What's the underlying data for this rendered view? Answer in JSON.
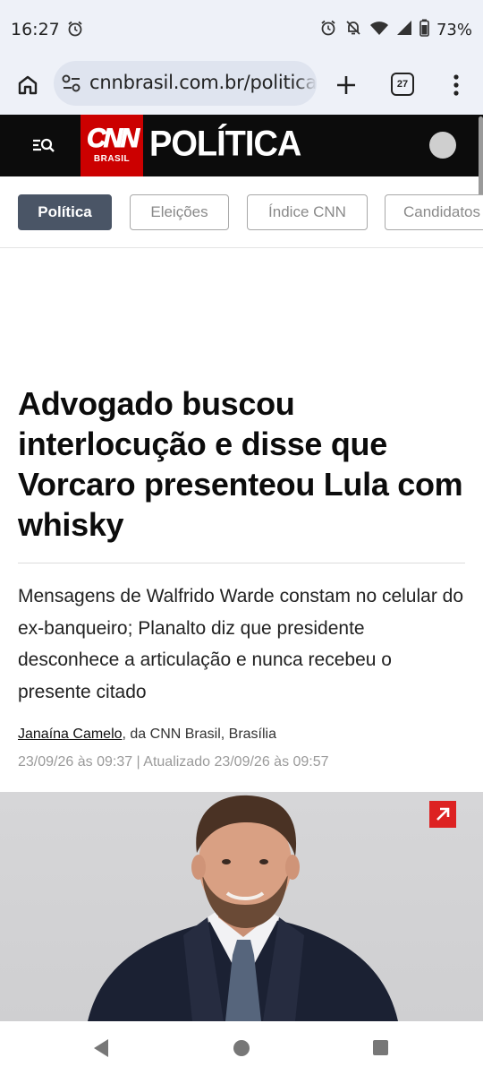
{
  "status_bar": {
    "time": "16:27",
    "battery": "73%",
    "icons": [
      "alarm-icon",
      "alarm-icon",
      "bell-off-icon",
      "wifi-icon",
      "signal-icon",
      "battery-icon"
    ]
  },
  "browser": {
    "url": "cnnbrasil.com.br/politica",
    "tab_count": "27",
    "icons": [
      "home-icon",
      "tune-icon",
      "plus-icon",
      "more-vert-icon"
    ]
  },
  "site_header": {
    "logo_text": "CNN",
    "logo_subtext": "BRASIL",
    "section_title": "POLÍTICA",
    "icons": [
      "menu-search-icon",
      "user-avatar"
    ]
  },
  "categories": [
    {
      "label": "Política",
      "active": true
    },
    {
      "label": "Eleições",
      "active": false
    },
    {
      "label": "Índice CNN",
      "active": false
    },
    {
      "label": "Candidatos",
      "active": false
    }
  ],
  "article": {
    "headline": "Advogado buscou interlocução e disse que Vorcaro presenteou Lula com whisky",
    "subheadline": "Mensagens de Walfrido Warde constam no celular do ex-banqueiro; Planalto diz que presidente desconhece a articulação e nunca recebeu o presente citado",
    "author": "Janaína Camelo",
    "byline_rest": ", da CNN Brasil, Brasília",
    "timestamp": "23/09/26 às 09:37 | Atualizado 23/09/26 às 09:57"
  },
  "colors": {
    "cnn_red": "#cc0000",
    "header_bg": "#0c0c0c",
    "active_chip": "#4a5566",
    "expand_button": "#dd2222",
    "browser_bar": "#eef1f8"
  }
}
